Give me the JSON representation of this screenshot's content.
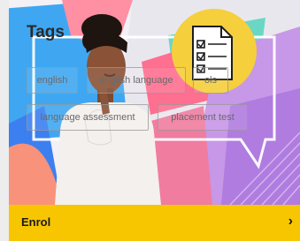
{
  "tags_section": {
    "title": "Tags",
    "tags": [
      "english",
      "english language",
      "ols",
      "language assessment",
      "placement test"
    ]
  },
  "enrol": {
    "label": "Enrol"
  },
  "icons": {
    "checklist": "clipboard-checklist-icon",
    "arrow": "chevron-right-icon"
  },
  "colors": {
    "enrol_bar": "#f7c600",
    "illustration_yellow": "#f5cf3c"
  }
}
